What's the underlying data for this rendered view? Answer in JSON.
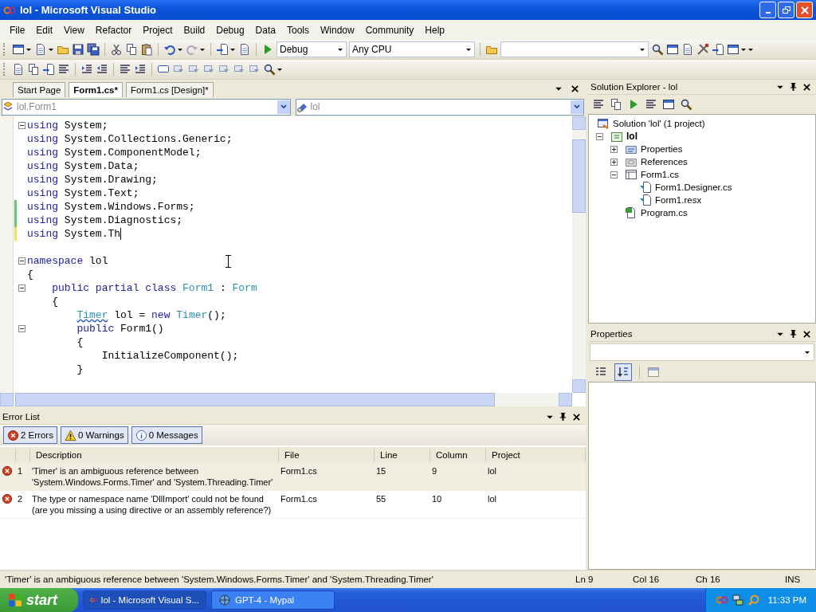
{
  "window": {
    "title": "lol - Microsoft Visual Studio"
  },
  "menu": [
    "File",
    "Edit",
    "View",
    "Refactor",
    "Project",
    "Build",
    "Debug",
    "Data",
    "Tools",
    "Window",
    "Community",
    "Help"
  ],
  "toolbar": {
    "configuration": "Debug",
    "platform": "Any CPU"
  },
  "editor": {
    "tabs": [
      {
        "label": "Start Page",
        "selected": false
      },
      {
        "label": "Form1.cs*",
        "selected": true
      },
      {
        "label": "Form1.cs [Design]*",
        "selected": false
      }
    ],
    "type_dropdown": "lol.Form1",
    "member_dropdown": "lol",
    "lines": [
      {
        "fold": true,
        "caret": false,
        "tokens": [
          {
            "kind": "kw",
            "text": "using"
          },
          {
            "kind": "plain",
            "text": " System;"
          }
        ]
      },
      {
        "fold": false,
        "caret": false,
        "tokens": [
          {
            "kind": "kw",
            "text": "using"
          },
          {
            "kind": "plain",
            "text": " System.Collections.Generic;"
          }
        ]
      },
      {
        "fold": false,
        "caret": false,
        "tokens": [
          {
            "kind": "kw",
            "text": "using"
          },
          {
            "kind": "plain",
            "text": " System.ComponentModel;"
          }
        ]
      },
      {
        "fold": false,
        "caret": false,
        "tokens": [
          {
            "kind": "kw",
            "text": "using"
          },
          {
            "kind": "plain",
            "text": " System.Data;"
          }
        ]
      },
      {
        "fold": false,
        "caret": false,
        "tokens": [
          {
            "kind": "kw",
            "text": "using"
          },
          {
            "kind": "plain",
            "text": " System.Drawing;"
          }
        ]
      },
      {
        "fold": false,
        "caret": false,
        "tokens": [
          {
            "kind": "kw",
            "text": "using"
          },
          {
            "kind": "plain",
            "text": " System.Text;"
          }
        ]
      },
      {
        "fold": false,
        "caret": false,
        "color": "#6cc36c",
        "tokens": [
          {
            "kind": "kw",
            "text": "using"
          },
          {
            "kind": "plain",
            "text": " System.Windows.Forms;"
          }
        ]
      },
      {
        "fold": false,
        "caret": false,
        "color": "#6cc36c",
        "tokens": [
          {
            "kind": "kw",
            "text": "using"
          },
          {
            "kind": "plain",
            "text": " System.Diagnostics;"
          }
        ]
      },
      {
        "fold": false,
        "caret": true,
        "color": "#f0e060",
        "tokens": [
          {
            "kind": "kw",
            "text": "using"
          },
          {
            "kind": "plain",
            "text": " System.Th"
          }
        ]
      },
      {
        "fold": false,
        "caret": false
      },
      {
        "fold": true,
        "caret": false,
        "tokens": [
          {
            "kind": "kw",
            "text": "namespace"
          },
          {
            "kind": "plain",
            "text": " lol"
          }
        ]
      },
      {
        "fold": false,
        "caret": false,
        "tokens": [
          {
            "kind": "plain",
            "text": "{"
          }
        ]
      },
      {
        "fold": true,
        "caret": false,
        "tokens": [
          {
            "kind": "kw",
            "text": "    public partial class "
          },
          {
            "kind": "type",
            "text": "Form1"
          },
          {
            "kind": "plain",
            "text": " : "
          },
          {
            "kind": "type",
            "text": "Form"
          }
        ]
      },
      {
        "fold": false,
        "caret": false,
        "tokens": [
          {
            "kind": "plain",
            "text": "    {"
          }
        ]
      },
      {
        "fold": false,
        "caret": false,
        "tokens": [
          {
            "kind": "error",
            "text": "        Timer"
          },
          {
            "kind": "plain",
            "text": " lol = "
          },
          {
            "kind": "kw",
            "text": "new "
          },
          {
            "kind": "type",
            "text": "Timer"
          },
          {
            "kind": "plain",
            "text": "();"
          }
        ]
      },
      {
        "fold": true,
        "caret": false,
        "tokens": [
          {
            "kind": "kw",
            "text": "        public"
          },
          {
            "kind": "plain",
            "text": " Form1()"
          }
        ]
      },
      {
        "fold": false,
        "caret": false,
        "tokens": [
          {
            "kind": "plain",
            "text": "        {"
          }
        ]
      },
      {
        "fold": false,
        "caret": false,
        "tokens": [
          {
            "kind": "plain",
            "text": "            InitializeComponent();"
          }
        ]
      },
      {
        "fold": false,
        "caret": false,
        "tokens": [
          {
            "kind": "plain",
            "text": "        }"
          }
        ]
      }
    ]
  },
  "solution_explorer": {
    "title": "Solution Explorer - lol",
    "tree": [
      {
        "label": "Solution 'lol' (1 project)",
        "kind": "solution",
        "children": [
          {
            "label": "lol",
            "kind": "project",
            "expanded": true,
            "children": [
              {
                "label": "Properties",
                "kind": "properties",
                "expanded": false
              },
              {
                "label": "References",
                "kind": "references",
                "expanded": false
              },
              {
                "label": "Form1.cs",
                "kind": "form",
                "expanded": true,
                "children": [
                  {
                    "label": "Form1.Designer.cs",
                    "kind": "dependent"
                  },
                  {
                    "label": "Form1.resx",
                    "kind": "dependent"
                  }
                ]
              },
              {
                "label": "Program.cs",
                "kind": "code"
              }
            ]
          }
        ]
      }
    ]
  },
  "properties": {
    "title": "Properties",
    "sort_buttons": [
      {
        "kind": "categorized",
        "selected": false
      },
      {
        "kind": "alphabetical",
        "selected": true
      }
    ]
  },
  "error_list": {
    "title": "Error List",
    "filters": [
      {
        "kind": "error",
        "label": "2 Errors",
        "selected": true
      },
      {
        "kind": "warning",
        "label": "0 Warnings",
        "selected": true
      },
      {
        "kind": "info",
        "label": "0 Messages",
        "selected": true
      }
    ],
    "columns": [
      "Description",
      "File",
      "Line",
      "Column",
      "Project"
    ],
    "rows": [
      {
        "number": "1",
        "description": "'Timer' is an ambiguous reference between 'System.Windows.Forms.Timer' and 'System.Threading.Timer'",
        "file": "Form1.cs",
        "line": "15",
        "column": "9",
        "project": "lol",
        "selected": true
      },
      {
        "number": "2",
        "description": "The type or namespace name 'DllImport' could not be found (are you missing a using directive or an assembly reference?)",
        "file": "Form1.cs",
        "line": "55",
        "column": "10",
        "project": "lol",
        "selected": false
      }
    ]
  },
  "status_bar": {
    "message": "'Timer' is an ambiguous reference between 'System.Windows.Forms.Timer' and 'System.Threading.Timer'",
    "line": "Ln 9",
    "col": "Col 16",
    "ch": "Ch 16",
    "mode": "INS"
  },
  "taskbar": {
    "start": "start",
    "tasks": [
      {
        "label": "lol - Microsoft Visual S...",
        "kind": "studio",
        "selected": true
      },
      {
        "label": "GPT-4 - Mypal",
        "kind": "browser",
        "selected": false
      }
    ],
    "clock": "11:33 PM"
  }
}
